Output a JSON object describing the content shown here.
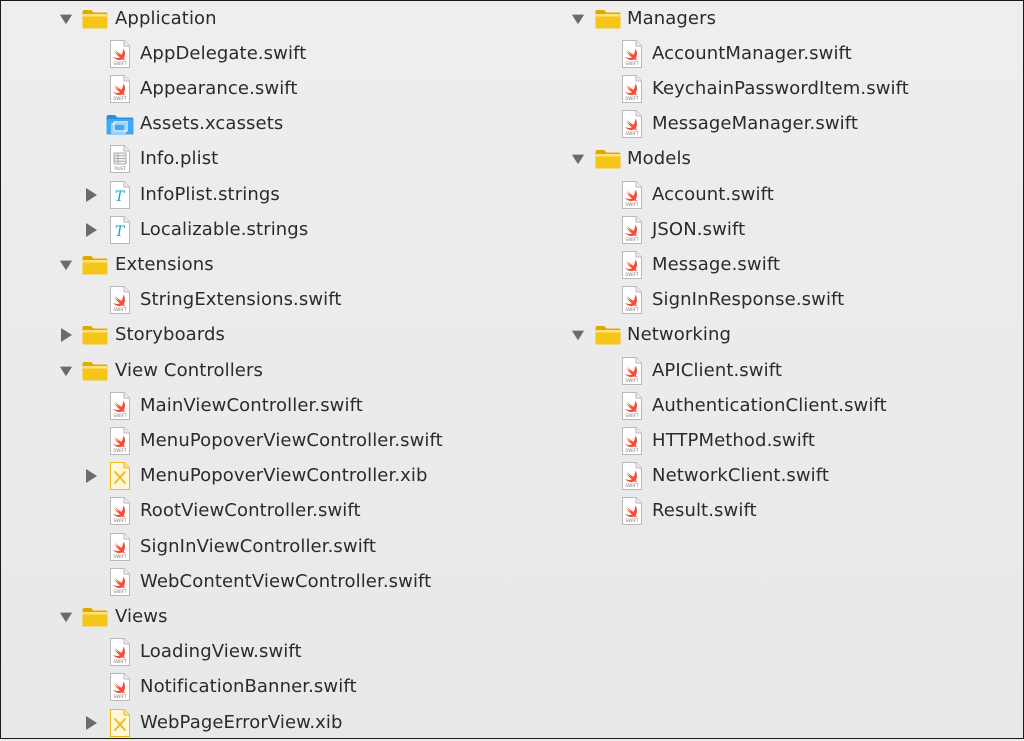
{
  "left_tree": [
    {
      "type": "folder",
      "label": "Application",
      "expanded": true,
      "depth": 0,
      "icon": "folder-icon"
    },
    {
      "type": "file",
      "label": "AppDelegate.swift",
      "depth": 1,
      "icon": "swift-file-icon"
    },
    {
      "type": "file",
      "label": "Appearance.swift",
      "depth": 1,
      "icon": "swift-file-icon"
    },
    {
      "type": "file",
      "label": "Assets.xcassets",
      "depth": 1,
      "icon": "asset-catalog-icon"
    },
    {
      "type": "file",
      "label": "Info.plist",
      "depth": 1,
      "icon": "plist-file-icon"
    },
    {
      "type": "group",
      "label": "InfoPlist.strings",
      "depth": 1,
      "expanded": false,
      "icon": "strings-file-icon"
    },
    {
      "type": "group",
      "label": "Localizable.strings",
      "depth": 1,
      "expanded": false,
      "icon": "strings-file-icon"
    },
    {
      "type": "folder",
      "label": "Extensions",
      "expanded": true,
      "depth": 0,
      "icon": "folder-icon"
    },
    {
      "type": "file",
      "label": "StringExtensions.swift",
      "depth": 1,
      "icon": "swift-file-icon"
    },
    {
      "type": "folder",
      "label": "Storyboards",
      "expanded": false,
      "depth": 0,
      "icon": "folder-icon"
    },
    {
      "type": "folder",
      "label": "View Controllers",
      "expanded": true,
      "depth": 0,
      "icon": "folder-icon"
    },
    {
      "type": "file",
      "label": "MainViewController.swift",
      "depth": 1,
      "icon": "swift-file-icon"
    },
    {
      "type": "file",
      "label": "MenuPopoverViewController.swift",
      "depth": 1,
      "icon": "swift-file-icon"
    },
    {
      "type": "group",
      "label": "MenuPopoverViewController.xib",
      "depth": 1,
      "expanded": false,
      "icon": "xib-file-icon"
    },
    {
      "type": "file",
      "label": "RootViewController.swift",
      "depth": 1,
      "icon": "swift-file-icon"
    },
    {
      "type": "file",
      "label": "SignInViewController.swift",
      "depth": 1,
      "icon": "swift-file-icon"
    },
    {
      "type": "file",
      "label": "WebContentViewController.swift",
      "depth": 1,
      "icon": "swift-file-icon"
    },
    {
      "type": "folder",
      "label": "Views",
      "expanded": true,
      "depth": 0,
      "icon": "folder-icon"
    },
    {
      "type": "file",
      "label": "LoadingView.swift",
      "depth": 1,
      "icon": "swift-file-icon"
    },
    {
      "type": "file",
      "label": "NotificationBanner.swift",
      "depth": 1,
      "icon": "swift-file-icon"
    },
    {
      "type": "group",
      "label": "WebPageErrorView.xib",
      "depth": 1,
      "expanded": false,
      "icon": "xib-file-icon"
    }
  ],
  "right_tree": [
    {
      "type": "folder",
      "label": "Managers",
      "expanded": true,
      "depth": 0,
      "icon": "folder-icon"
    },
    {
      "type": "file",
      "label": "AccountManager.swift",
      "depth": 1,
      "icon": "swift-file-icon"
    },
    {
      "type": "file",
      "label": "KeychainPasswordItem.swift",
      "depth": 1,
      "icon": "swift-file-icon"
    },
    {
      "type": "file",
      "label": "MessageManager.swift",
      "depth": 1,
      "icon": "swift-file-icon"
    },
    {
      "type": "folder",
      "label": "Models",
      "expanded": true,
      "depth": 0,
      "icon": "folder-icon"
    },
    {
      "type": "file",
      "label": "Account.swift",
      "depth": 1,
      "icon": "swift-file-icon"
    },
    {
      "type": "file",
      "label": "JSON.swift",
      "depth": 1,
      "icon": "swift-file-icon"
    },
    {
      "type": "file",
      "label": "Message.swift",
      "depth": 1,
      "icon": "swift-file-icon"
    },
    {
      "type": "file",
      "label": "SignInResponse.swift",
      "depth": 1,
      "icon": "swift-file-icon"
    },
    {
      "type": "folder",
      "label": "Networking",
      "expanded": true,
      "depth": 0,
      "icon": "folder-icon"
    },
    {
      "type": "file",
      "label": "APIClient.swift",
      "depth": 1,
      "icon": "swift-file-icon"
    },
    {
      "type": "file",
      "label": "AuthenticationClient.swift",
      "depth": 1,
      "icon": "swift-file-icon"
    },
    {
      "type": "file",
      "label": "HTTPMethod.swift",
      "depth": 1,
      "icon": "swift-file-icon"
    },
    {
      "type": "file",
      "label": "NetworkClient.swift",
      "depth": 1,
      "icon": "swift-file-icon"
    },
    {
      "type": "file",
      "label": "Result.swift",
      "depth": 1,
      "icon": "swift-file-icon"
    }
  ],
  "colors": {
    "text": "#2b2b2b",
    "folder_yellow": "#f5c518",
    "swift_orange": "#f05138",
    "asset_blue": "#3fa9f5",
    "strings_cyan": "#1c9bd6",
    "xib_yellow": "#e8b923",
    "disclosure": "#6b6b6b"
  }
}
